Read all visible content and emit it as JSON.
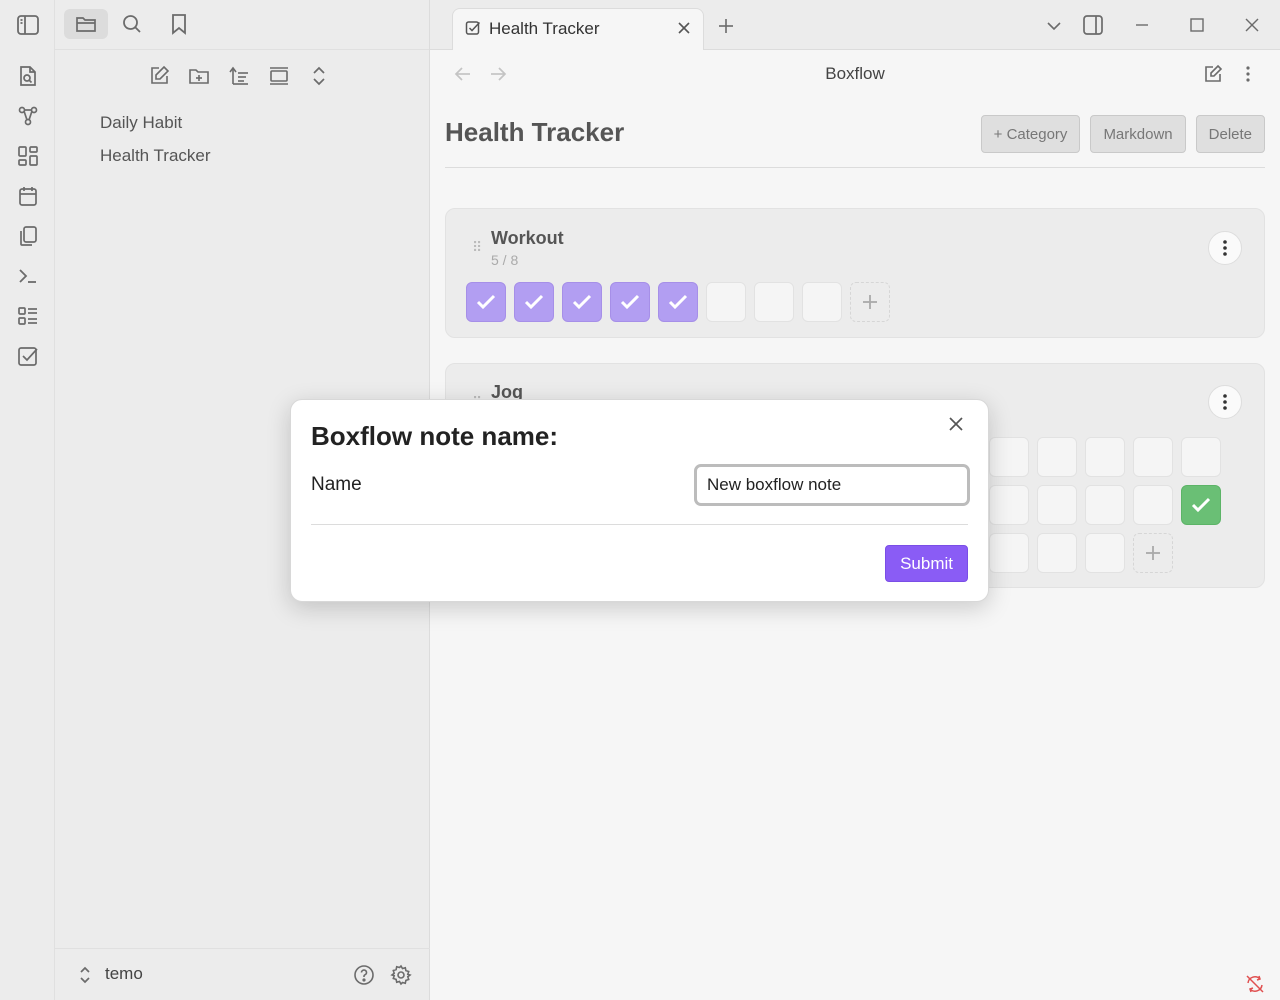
{
  "sidebar": {
    "files": [
      "Daily Habit",
      "Health Tracker"
    ],
    "vault_name": "temo"
  },
  "tabs": [
    {
      "label": "Health Tracker"
    }
  ],
  "view": {
    "title": "Boxflow"
  },
  "page": {
    "title": "Health Tracker",
    "buttons": {
      "category": "+ Category",
      "markdown": "Markdown",
      "delete": "Delete"
    }
  },
  "cards": [
    {
      "title": "Workout",
      "count": "5 / 8",
      "done": 5,
      "total": 8
    },
    {
      "title": "Jog"
    }
  ],
  "modal": {
    "title": "Boxflow note name:",
    "field_label": "Name",
    "field_value": "New boxflow note",
    "submit_label": "Submit"
  },
  "colors": {
    "accent": "#8a5cf5",
    "checked_box": "#b29ef2",
    "green_box": "#6abf75"
  }
}
